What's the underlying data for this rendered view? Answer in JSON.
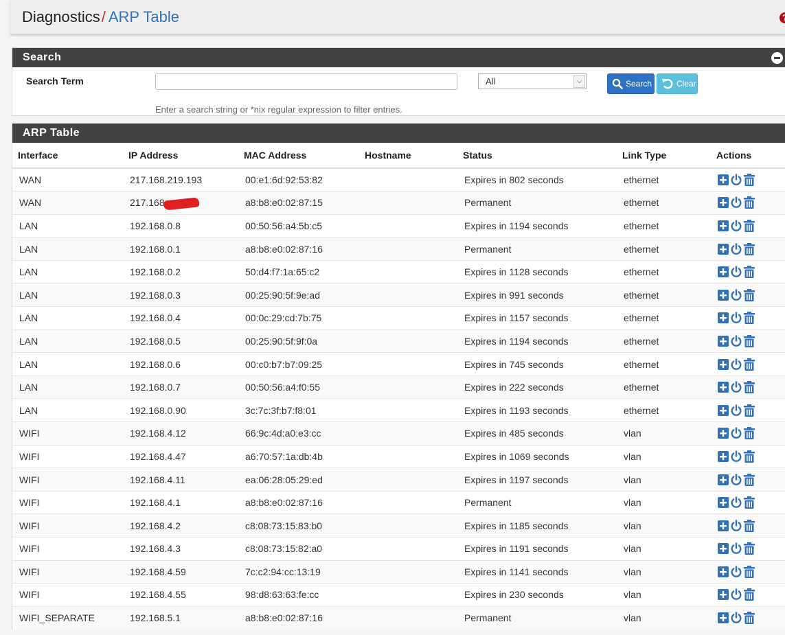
{
  "breadcrumb": {
    "section": "Diagnostics",
    "separator": "/",
    "page": "ARP Table"
  },
  "help_icon": "question-circle-icon",
  "search": {
    "panel_title": "Search",
    "term_label": "Search Term",
    "input_value": "",
    "select_value": "All",
    "search_button": "Search",
    "clear_button": "Clear",
    "hint": "Enter a search string or *nix regular expression to filter entries."
  },
  "arp": {
    "panel_title": "ARP Table",
    "columns": [
      "Interface",
      "IP Address",
      "MAC Address",
      "Hostname",
      "Status",
      "Link Type",
      "Actions"
    ],
    "rows": [
      {
        "iface": "WAN",
        "ip": "217.168.219.193",
        "mac": "00:e1:6d:92:53:82",
        "host": "",
        "status": "Expires in 802 seconds",
        "link": "ethernet"
      },
      {
        "iface": "WAN",
        "ip": "217.168",
        "mac": "a8:b8:e0:02:87:15",
        "host": "",
        "status": "Permanent",
        "link": "ethernet",
        "redacted": true
      },
      {
        "iface": "LAN",
        "ip": "192.168.0.8",
        "mac": "00:50:56:a4:5b:c5",
        "host": "",
        "status": "Expires in 1194 seconds",
        "link": "ethernet"
      },
      {
        "iface": "LAN",
        "ip": "192.168.0.1",
        "mac": "a8:b8:e0:02:87:16",
        "host": "",
        "status": "Permanent",
        "link": "ethernet"
      },
      {
        "iface": "LAN",
        "ip": "192.168.0.2",
        "mac": "50:d4:f7:1a:65:c2",
        "host": "",
        "status": "Expires in 1128 seconds",
        "link": "ethernet"
      },
      {
        "iface": "LAN",
        "ip": "192.168.0.3",
        "mac": "00:25:90:5f:9e:ad",
        "host": "",
        "status": "Expires in 991 seconds",
        "link": "ethernet"
      },
      {
        "iface": "LAN",
        "ip": "192.168.0.4",
        "mac": "00:0c:29:cd:7b:75",
        "host": "",
        "status": "Expires in 1157 seconds",
        "link": "ethernet"
      },
      {
        "iface": "LAN",
        "ip": "192.168.0.5",
        "mac": "00:25:90:5f:9f:0a",
        "host": "",
        "status": "Expires in 1194 seconds",
        "link": "ethernet"
      },
      {
        "iface": "LAN",
        "ip": "192.168.0.6",
        "mac": "00:c0:b7:b7:09:25",
        "host": "",
        "status": "Expires in 745 seconds",
        "link": "ethernet"
      },
      {
        "iface": "LAN",
        "ip": "192.168.0.7",
        "mac": "00:50:56:a4:f0:55",
        "host": "",
        "status": "Expires in 222 seconds",
        "link": "ethernet"
      },
      {
        "iface": "LAN",
        "ip": "192.168.0.90",
        "mac": "3c:7c:3f:b7:f8:01",
        "host": "",
        "status": "Expires in 1193 seconds",
        "link": "ethernet"
      },
      {
        "iface": "WIFI",
        "ip": "192.168.4.12",
        "mac": "66:9c:4d:a0:e3:cc",
        "host": "",
        "status": "Expires in 485 seconds",
        "link": "vlan"
      },
      {
        "iface": "WIFI",
        "ip": "192.168.4.47",
        "mac": "a6:70:57:1a:db:4b",
        "host": "",
        "status": "Expires in 1069 seconds",
        "link": "vlan"
      },
      {
        "iface": "WIFI",
        "ip": "192.168.4.11",
        "mac": "ea:06:28:05:29:ed",
        "host": "",
        "status": "Expires in 1197 seconds",
        "link": "vlan"
      },
      {
        "iface": "WIFI",
        "ip": "192.168.4.1",
        "mac": "a8:b8:e0:02:87:16",
        "host": "",
        "status": "Permanent",
        "link": "vlan"
      },
      {
        "iface": "WIFI",
        "ip": "192.168.4.2",
        "mac": "c8:08:73:15:83:b0",
        "host": "",
        "status": "Expires in 1185 seconds",
        "link": "vlan"
      },
      {
        "iface": "WIFI",
        "ip": "192.168.4.3",
        "mac": "c8:08:73:15:82:a0",
        "host": "",
        "status": "Expires in 1191 seconds",
        "link": "vlan"
      },
      {
        "iface": "WIFI",
        "ip": "192.168.4.59",
        "mac": "7c:c2:94:cc:13:19",
        "host": "",
        "status": "Expires in 1141 seconds",
        "link": "vlan"
      },
      {
        "iface": "WIFI",
        "ip": "192.168.4.55",
        "mac": "98:d8:63:63:fe:cc",
        "host": "",
        "status": "Expires in 230 seconds",
        "link": "vlan"
      },
      {
        "iface": "WIFI_SEPARATE",
        "ip": "192.168.5.1",
        "mac": "a8:b8:e0:02:87:16",
        "host": "",
        "status": "Permanent",
        "link": "vlan"
      }
    ],
    "action_icons": [
      "plus-square-icon",
      "power-icon",
      "trash-icon"
    ]
  },
  "colors": {
    "accent": "#3371b7",
    "panel_header": "#424242",
    "search_btn": "#2f72c4",
    "clear_btn": "#5bc0de",
    "danger": "#b40c0c"
  }
}
